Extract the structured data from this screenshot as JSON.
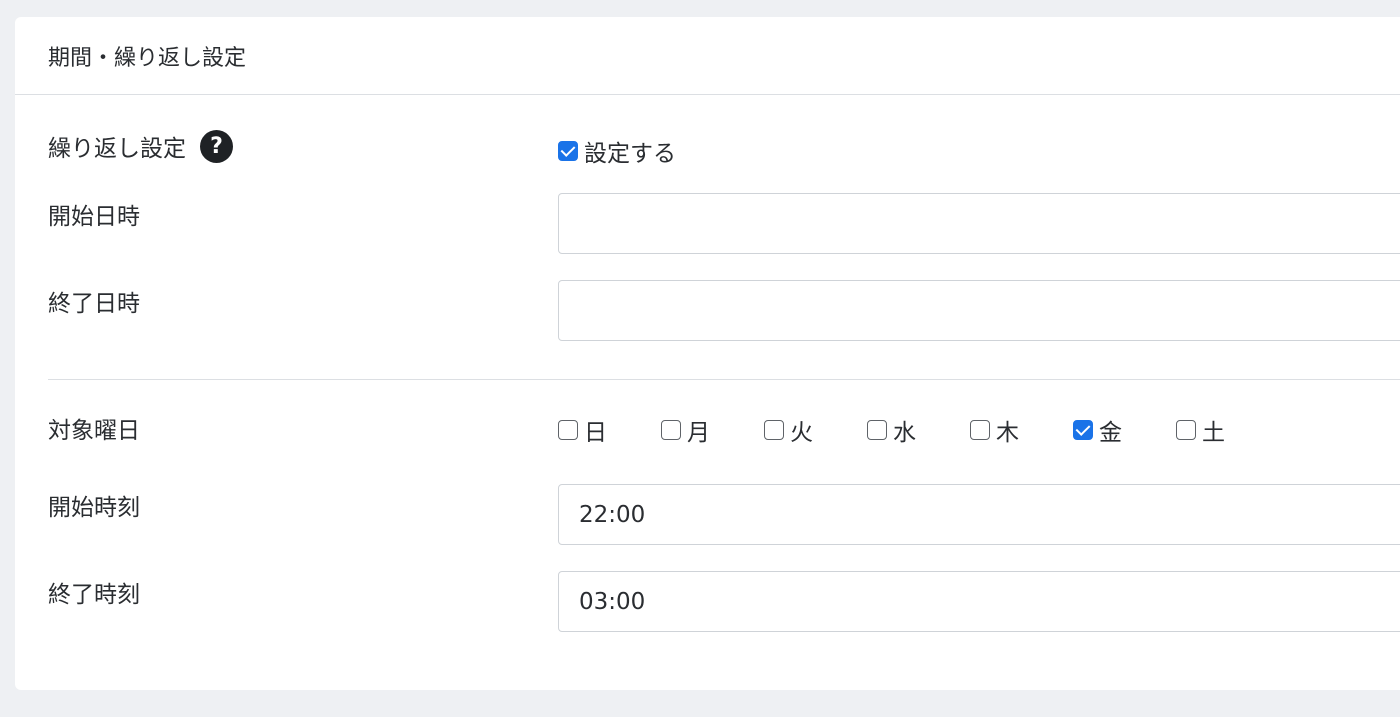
{
  "card": {
    "title": "期間・繰り返し設定"
  },
  "repeat": {
    "label": "繰り返し設定",
    "help_icon": "question-circle-icon",
    "help_glyph": "?",
    "checkbox_label": "設定する",
    "checked": true
  },
  "start_datetime": {
    "label": "開始日時",
    "value": ""
  },
  "end_datetime": {
    "label": "終了日時",
    "value": ""
  },
  "weekdays": {
    "label": "対象曜日",
    "days": [
      {
        "label": "日",
        "checked": false
      },
      {
        "label": "月",
        "checked": false
      },
      {
        "label": "火",
        "checked": false
      },
      {
        "label": "水",
        "checked": false
      },
      {
        "label": "木",
        "checked": false
      },
      {
        "label": "金",
        "checked": true
      },
      {
        "label": "土",
        "checked": false
      }
    ]
  },
  "start_time": {
    "label": "開始時刻",
    "value": "22:00"
  },
  "end_time": {
    "label": "終了時刻",
    "value": "03:00"
  },
  "colors": {
    "checkbox_checked": "#1a73e8",
    "page_background": "#eef0f3"
  }
}
